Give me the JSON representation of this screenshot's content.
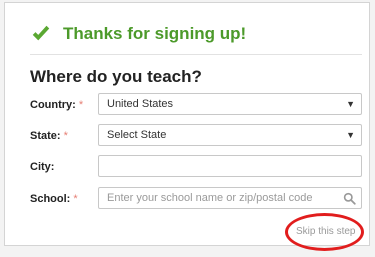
{
  "banner": {
    "text": "Thanks for signing up!",
    "icon": "check-icon",
    "color": "#4c9a2a"
  },
  "form": {
    "heading": "Where do you teach?",
    "required_marker": "*",
    "fields": {
      "country": {
        "label": "Country:",
        "value": "United States",
        "required": true,
        "icon": "caret-down-icon"
      },
      "state": {
        "label": "State:",
        "value": "Select State",
        "required": true,
        "icon": "caret-down-icon"
      },
      "city": {
        "label": "City:",
        "value": "",
        "required": false
      },
      "school": {
        "label": "School:",
        "placeholder": "Enter your school name or zip/postal code",
        "required": true,
        "icon": "search-icon"
      }
    }
  },
  "skip": {
    "label": "Skip this step"
  },
  "annotation": {
    "ring_color": "#e11d1d"
  }
}
